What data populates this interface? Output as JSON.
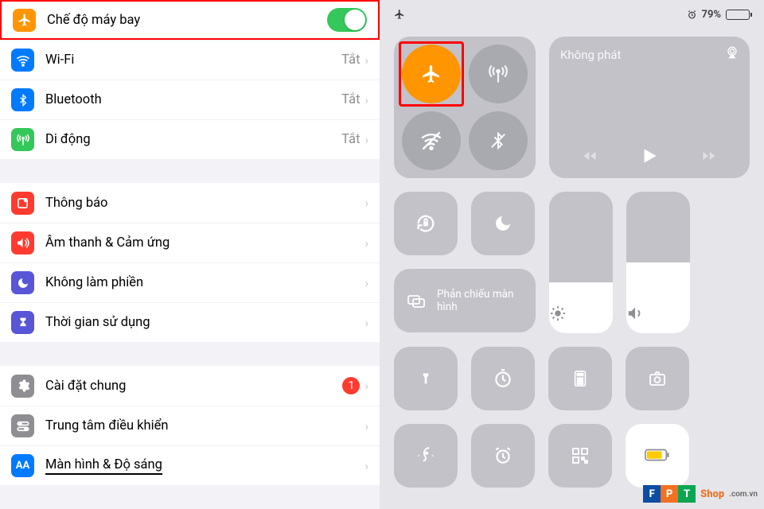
{
  "settings": {
    "groups": [
      {
        "rows": [
          {
            "icon": "plane-icon",
            "color": "orange",
            "label": "Chế độ máy bay",
            "switch": true,
            "highlight": true
          },
          {
            "icon": "wifi-icon",
            "color": "blue",
            "label": "Wi-Fi",
            "value": "Tắt",
            "chev": true
          },
          {
            "icon": "bluetooth-icon",
            "color": "blue",
            "label": "Bluetooth",
            "value": "Tắt",
            "chev": true
          },
          {
            "icon": "antenna-icon",
            "color": "green",
            "label": "Di động",
            "value": "Tắt",
            "chev": true
          }
        ]
      },
      {
        "rows": [
          {
            "icon": "bell-icon",
            "color": "red",
            "label": "Thông báo",
            "chev": true
          },
          {
            "icon": "speaker-icon",
            "color": "red",
            "label": "Âm thanh & Cảm ứng",
            "chev": true
          },
          {
            "icon": "moon-icon",
            "color": "purple",
            "label": "Không làm phiền",
            "chev": true
          },
          {
            "icon": "hourglass-icon",
            "color": "purple",
            "label": "Thời gian sử dụng",
            "chev": true
          }
        ]
      },
      {
        "rows": [
          {
            "icon": "gear-icon",
            "color": "gray",
            "label": "Cài đặt chung",
            "badge": "1",
            "chev": true
          },
          {
            "icon": "toggles-icon",
            "color": "gray",
            "label": "Trung tâm điều khiển",
            "chev": true
          },
          {
            "icon": "aa-icon",
            "color": "blue",
            "label": "Màn hình & Độ sáng",
            "chev": true,
            "underline": true
          }
        ]
      }
    ]
  },
  "status": {
    "battery_pct": "79%"
  },
  "control_center": {
    "music": {
      "title": "Không phát"
    },
    "mirror_label": "Phản chiếu màn hình",
    "brightness_pct": 36,
    "volume_pct": 50
  },
  "brand": {
    "text": "Shop",
    "suffix": ".com.vn"
  }
}
